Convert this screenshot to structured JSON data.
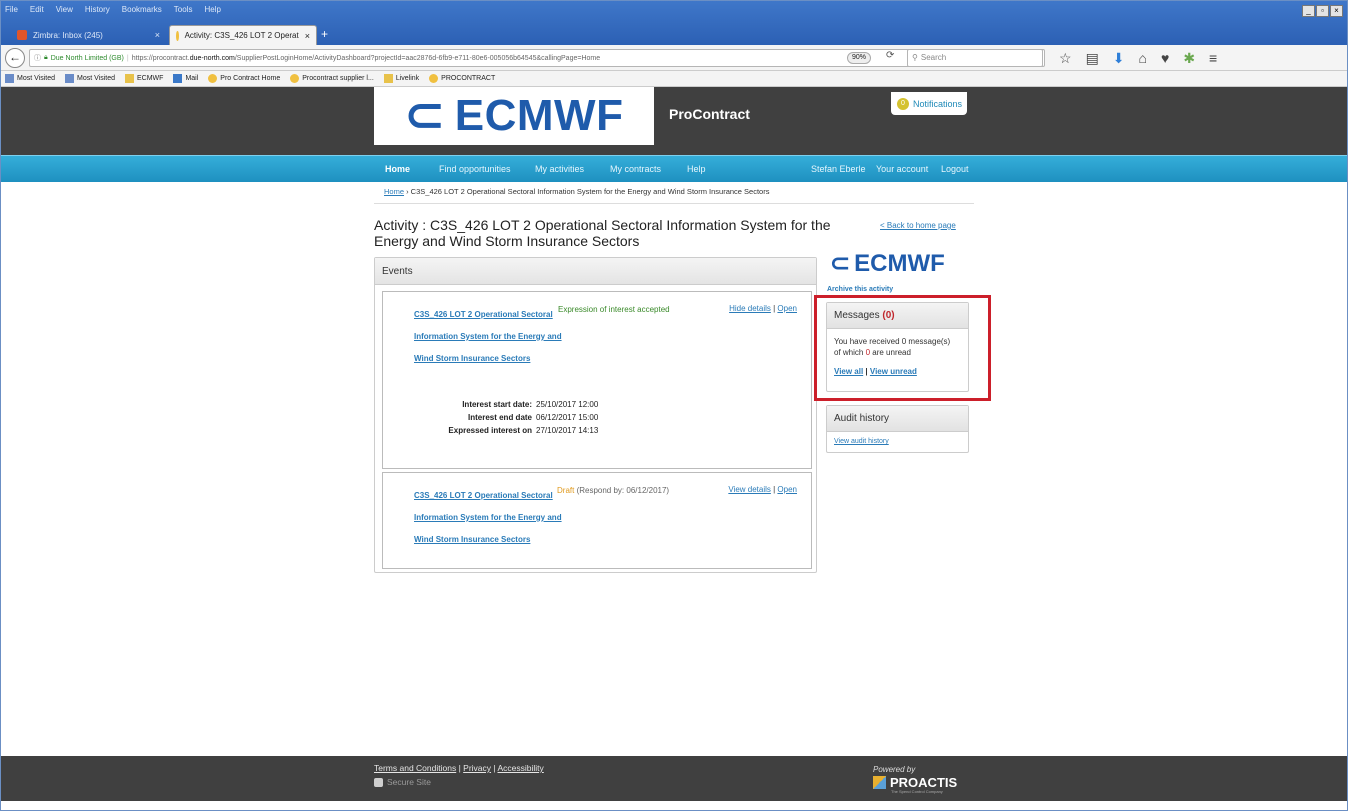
{
  "browser": {
    "menu": [
      "File",
      "Edit",
      "View",
      "History",
      "Bookmarks",
      "Tools",
      "Help"
    ],
    "tabs": [
      {
        "label": "Zimbra: Inbox (245)",
        "active": false
      },
      {
        "label": "Activity: C3S_426 LOT 2 Operat",
        "active": true
      }
    ],
    "new_tab": "+",
    "url_owner": "Due North Limited (GB)",
    "url_prefix": "https://procontract.",
    "url_domain": "due-north.com",
    "url_suffix": "/SupplierPostLoginHome/ActivityDashboard?projectId=aac2876d-6fb9-e711-80e6-005056b64545&callingPage=Home",
    "zoom": "90%",
    "search_placeholder": "Search",
    "bookmarks": [
      "Most Visited",
      "Most Visited",
      "ECMWF",
      "Mail",
      "Pro Contract Home",
      "Procontract supplier l...",
      "Livelink",
      "PROCONTRACT"
    ]
  },
  "header": {
    "logo_text": "ECMWF",
    "app_name": "ProContract",
    "notifications_count": "0",
    "notifications_label": "Notifications"
  },
  "nav": {
    "items": [
      "Home",
      "Find opportunities",
      "My activities",
      "My contracts",
      "Help"
    ],
    "user": "Stefan Eberle",
    "account": "Your account",
    "logout": "Logout"
  },
  "breadcrumb": {
    "home": "Home",
    "current": " › C3S_426 LOT 2 Operational Sectoral Information System for the Energy and Wind Storm Insurance Sectors"
  },
  "activity": {
    "title": "Activity : C3S_426 LOT 2 Operational Sectoral Information System for the Energy and Wind Storm Insurance Sectors",
    "back_link": "< Back to home page"
  },
  "events": {
    "heading": "Events",
    "items": [
      {
        "title": "C3S_426 LOT 2 Operational Sectoral Information System for the Energy and Wind Storm Insurance Sectors",
        "status": "Expression of interest accepted",
        "status_color": "#3a8a2a",
        "action1": "Hide details",
        "action2": "Open",
        "details": [
          {
            "label": "Interest start date:",
            "value": "25/10/2017 12:00"
          },
          {
            "label": "Interest end date",
            "value": "06/12/2017 15:00"
          },
          {
            "label": "Expressed interest on",
            "value": "27/10/2017 14:13"
          }
        ]
      },
      {
        "title": "C3S_426 LOT 2 Operational Sectoral Information System for the Energy and Wind Storm Insurance Sectors",
        "status": "Draft",
        "status_color": "#e09a1e",
        "status_note": " (Respond by: 06/12/2017)",
        "action1": "View details",
        "action2": "Open"
      }
    ]
  },
  "sidebar": {
    "logo_text": "ECMWF",
    "archive": "Archive this activity",
    "messages": {
      "heading": "Messages",
      "count": "(0)",
      "line1": "You have received 0 message(s)",
      "line2_pre": "of which ",
      "unread_count": "0",
      "line2_post": " are unread",
      "view_all": "View all",
      "view_unread": "View unread"
    },
    "audit": {
      "heading": "Audit history",
      "link": "View audit history"
    }
  },
  "footer": {
    "terms": "Terms and Conditions",
    "privacy": "Privacy",
    "accessibility": "Accessibility",
    "secure": "Secure Site",
    "powered": "Powered by",
    "proactis": "PROACTIS",
    "proactis_sub": "The Spend Control Company"
  },
  "colors": {
    "highlight": "#cc1f2a",
    "nav": "#1e90c0",
    "header": "#404040",
    "link": "#2a7bb8"
  }
}
